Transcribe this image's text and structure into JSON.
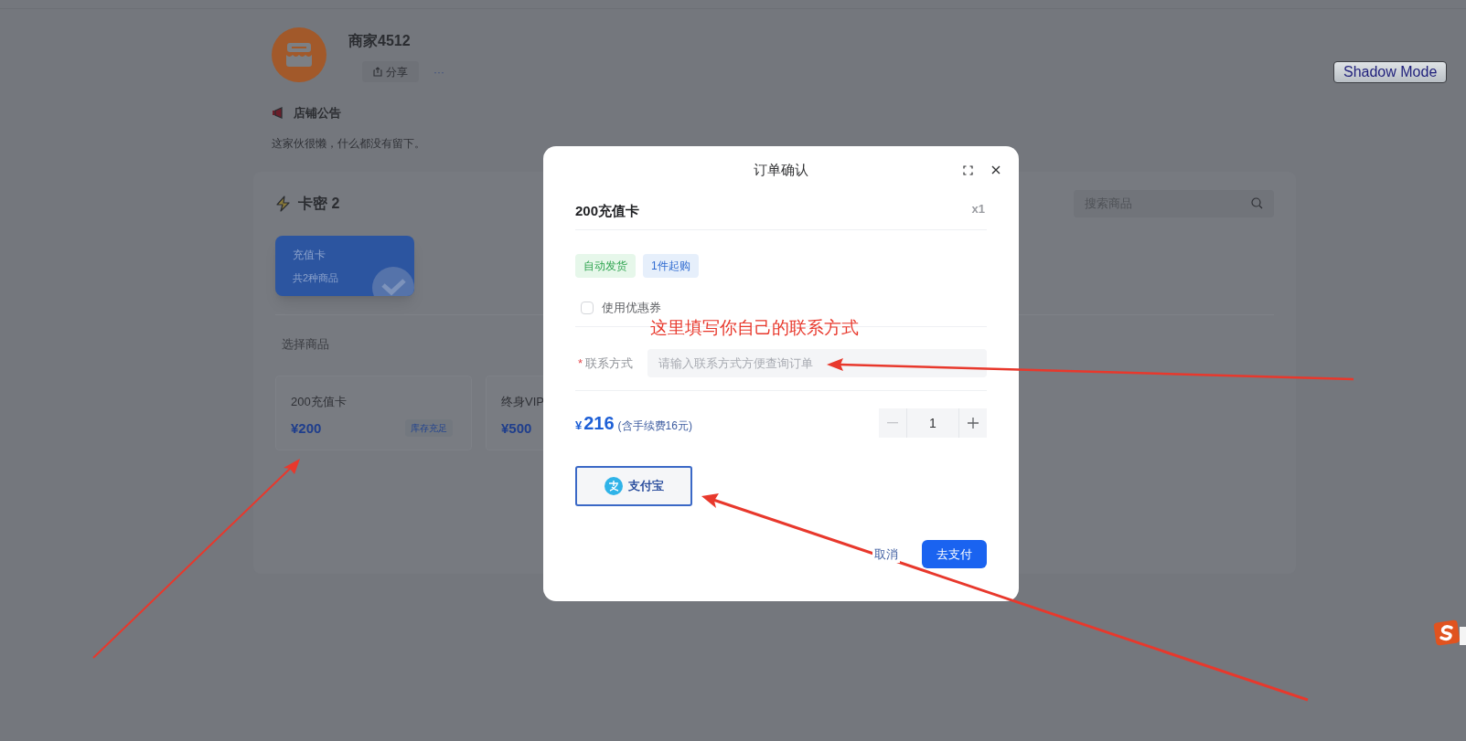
{
  "shop": {
    "name": "商家4512",
    "share_button": "分享",
    "more_button": "···",
    "notice_title": "店铺公告",
    "notice_text": "这家伙很懒，什么都没有留下。"
  },
  "shadow_mode_button": "Shadow Mode",
  "catalog": {
    "title": "卡密 2",
    "search": {
      "placeholder": "搜索商品"
    },
    "categories": [
      {
        "name": "充值卡",
        "count": "共2种商品",
        "selected": true
      }
    ],
    "section_label": "选择商品",
    "products": [
      {
        "name": "200充值卡",
        "price": "¥200",
        "stock": "库存充足"
      },
      {
        "name": "终身VIP",
        "price": "¥500"
      }
    ]
  },
  "dialog": {
    "title": "订单确认",
    "product": "200充值卡",
    "quantity_badge": "x1",
    "tags": [
      {
        "label": "自动发货",
        "kind": "success"
      },
      {
        "label": "1件起购",
        "kind": "info"
      }
    ],
    "coupon": {
      "label": "使用优惠券",
      "checked": false
    },
    "contact": {
      "required_mark": "*",
      "label": "联系方式",
      "placeholder": "请输入联系方式方便查询订单"
    },
    "total": {
      "currency": "¥",
      "amount": "216",
      "fee_note": "(含手续费16元)"
    },
    "quantity": {
      "value": "1"
    },
    "payment_methods": [
      {
        "label": "支付宝",
        "selected": true
      }
    ],
    "cancel_button": "取消",
    "pay_button": "去支付"
  },
  "annotation": {
    "text": "这里填写你自己的联系方式"
  }
}
